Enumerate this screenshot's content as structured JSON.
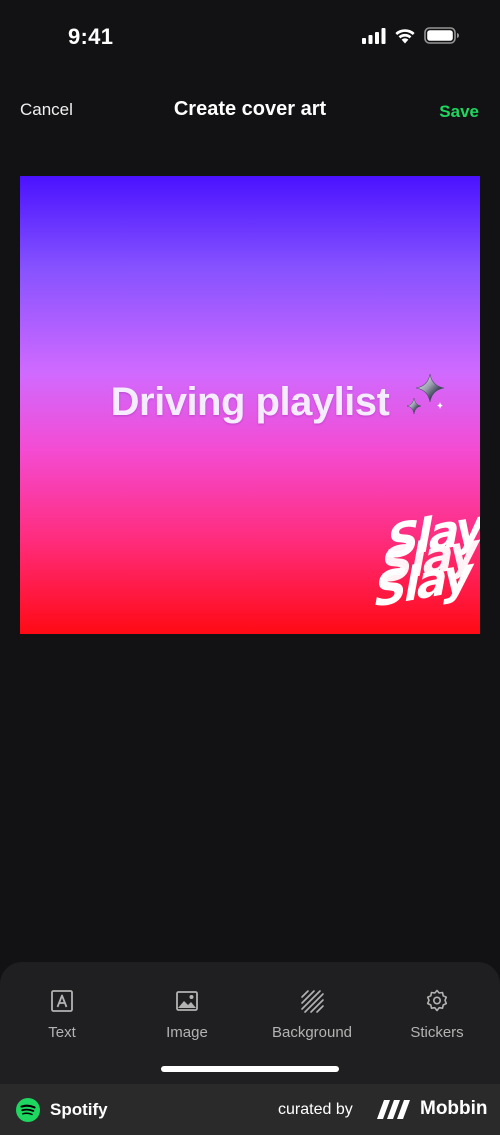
{
  "status_bar": {
    "time": "9:41"
  },
  "nav": {
    "cancel_label": "Cancel",
    "title": "Create cover art",
    "save_label": "Save"
  },
  "cover": {
    "title_text": "Driving playlist",
    "sticker_text": "Slay",
    "gradient_colors": [
      "#4a12ff",
      "#d06aff",
      "#ff0a14"
    ]
  },
  "toolbar": {
    "items": [
      {
        "label": "Text",
        "icon": "text-icon"
      },
      {
        "label": "Image",
        "icon": "image-icon"
      },
      {
        "label": "Background",
        "icon": "background-icon"
      },
      {
        "label": "Stickers",
        "icon": "sticker-icon"
      }
    ]
  },
  "footer": {
    "app_name": "Spotify",
    "curated_by": "curated by",
    "brand": "Mobbin"
  },
  "colors": {
    "accent": "#1ed760",
    "background": "#121214",
    "sheet": "#1f1f21"
  }
}
